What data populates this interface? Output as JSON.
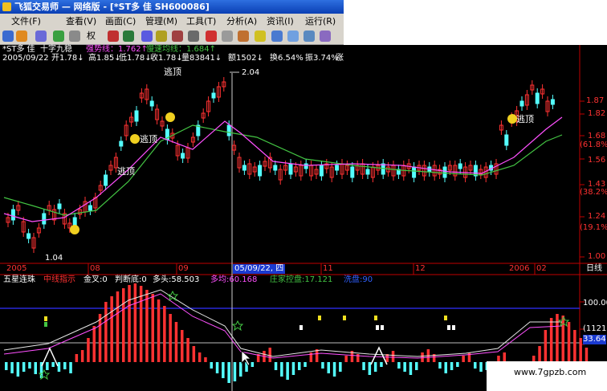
{
  "window": {
    "title": "飞狐交易师 — 网络版 - [*ST多 佳 SH600086]"
  },
  "menu": [
    "文件(F)",
    "查看(V)",
    "画面(C)",
    "管理(M)",
    "工具(T)",
    "分析(A)",
    "资讯(I)",
    "运行(R)"
  ],
  "toolbar": {
    "weight_label": "权"
  },
  "price_panel": {
    "title_stock": "*ST多 佳",
    "title_ind": "十字九稳",
    "strong_line": "强势线：1.762↑",
    "slow_avg": "慢速均线：1.684↑",
    "info_date": "2005/09/22",
    "info_open": "开1.78↓",
    "info_high": "高1.85↓",
    "info_low": "低1.78↓",
    "info_close": "收1.78↓",
    "info_vol": "量83841↓",
    "info_amt": "额1502↓",
    "info_turn": "换6.54%",
    "info_amp": "振3.74%",
    "info_tail": "涨",
    "annot_1": "逃顶",
    "annot_2": "逃顶",
    "annot_3": "逃顶",
    "annot_4": "逃顶",
    "price_high": "2.04",
    "price_low": "1.04",
    "axis": [
      "1.87",
      "1.82",
      "(61.8%)",
      "1.68",
      "1.56",
      "1.43",
      "(38.2%)",
      "1.24",
      "(19.1%)",
      "1.00"
    ]
  },
  "date_axis": {
    "year_2005": "2005",
    "m08": "08",
    "m09": "09",
    "cursor_date": "05/09/22, 四",
    "m11": "11",
    "m12": "12",
    "year_2006": "2006",
    "m02": "02",
    "period": "日线"
  },
  "indicator_panel": {
    "name": "五星连珠",
    "mid": "中线指示",
    "cross": "金叉:0",
    "bottom": "判断底:0",
    "bull": "多头:58.503",
    "avg": "多均:60.168",
    "control": "庄家控盘:17.121",
    "tail": "洗盘:90",
    "axis_100": "100.00",
    "axis_mid": "(1121)",
    "axis_val": "33.64"
  },
  "watermark": "www.7gpzb.com",
  "colors": {
    "up": "#ff3232",
    "down": "#54ffff",
    "line_green": "#43c443",
    "line_pink": "#ff50ff",
    "line_white": "#e6e6e6",
    "axis_red": "#c00000",
    "title_blue": "#1a4fd0"
  }
}
